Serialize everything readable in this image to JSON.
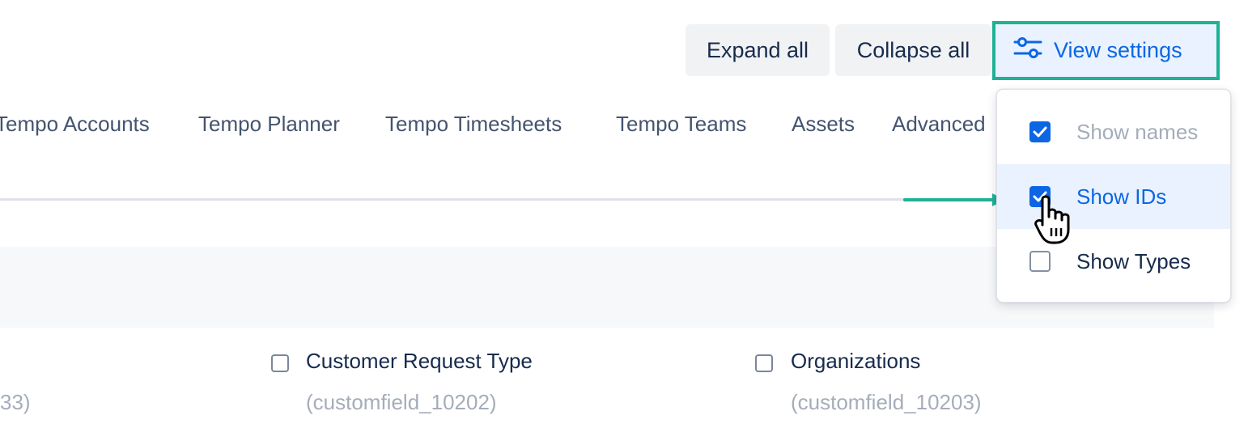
{
  "toolbar": {
    "expand_all": "Expand all",
    "collapse_all": "Collapse all",
    "view_settings": "View settings"
  },
  "tabs": [
    "Tempo Accounts",
    "Tempo Planner",
    "Tempo Timesheets",
    "Tempo Teams",
    "Assets",
    "Advanced"
  ],
  "view_settings_menu": {
    "items": [
      {
        "label": "Show names",
        "checked": true,
        "state": "disabled"
      },
      {
        "label": "Show IDs",
        "checked": true,
        "state": "hover"
      },
      {
        "label": "Show Types",
        "checked": false,
        "state": "normal"
      }
    ]
  },
  "fields": [
    {
      "name": "",
      "id": "33)"
    },
    {
      "name": "Customer Request Type",
      "id": "(customfield_10202)"
    },
    {
      "name": "Organizations",
      "id": "(customfield_10203)"
    }
  ],
  "colors": {
    "accent": "#0c66e4",
    "highlight": "#1fb195",
    "text": "#172b4d",
    "muted": "#a5adba"
  }
}
